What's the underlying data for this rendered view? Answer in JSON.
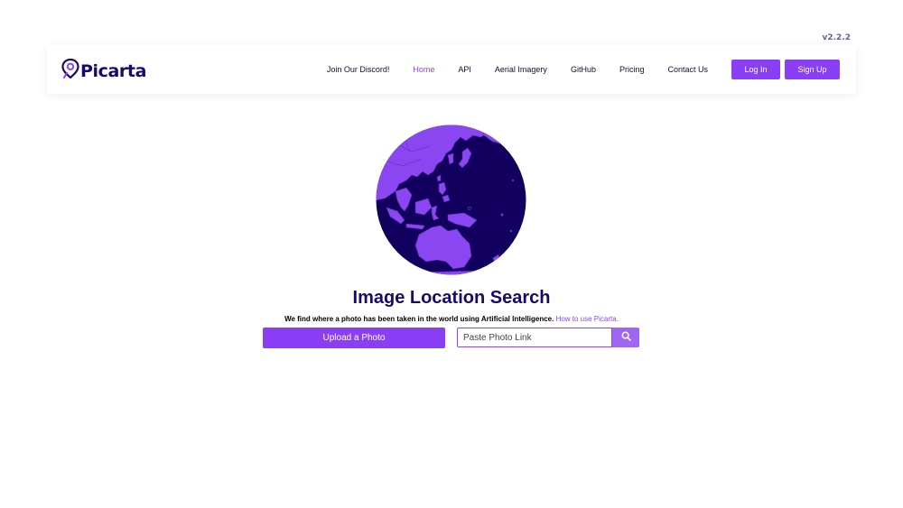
{
  "version": "v2.2.2",
  "brand": {
    "name": "Picarta",
    "icon": "map-pin-icon",
    "color": "#160a6e"
  },
  "nav": {
    "links": [
      {
        "label": "Join Our Discord!",
        "active": false
      },
      {
        "label": "Home",
        "active": true
      },
      {
        "label": "API",
        "active": false
      },
      {
        "label": "Aerial Imagery",
        "active": false
      },
      {
        "label": "GitHub",
        "active": false
      },
      {
        "label": "Pricing",
        "active": false
      },
      {
        "label": "Contact Us",
        "active": false
      }
    ],
    "login_label": "Log In",
    "signup_label": "Sign Up"
  },
  "hero": {
    "globe_icon": "globe-icon",
    "title": "Image Location Search",
    "subtitle_bold": "We find where a photo has been taken in the world using Artificial Intelligence.",
    "subtitle_link": "How to use Picarta.",
    "upload_label": "Upload a Photo",
    "link_placeholder": "Paste Photo Link",
    "search_icon": "search-icon"
  },
  "colors": {
    "accent": "#8a3ff5",
    "navy": "#160a6e",
    "ocean": "#12005e",
    "land": "#8a46f0"
  }
}
